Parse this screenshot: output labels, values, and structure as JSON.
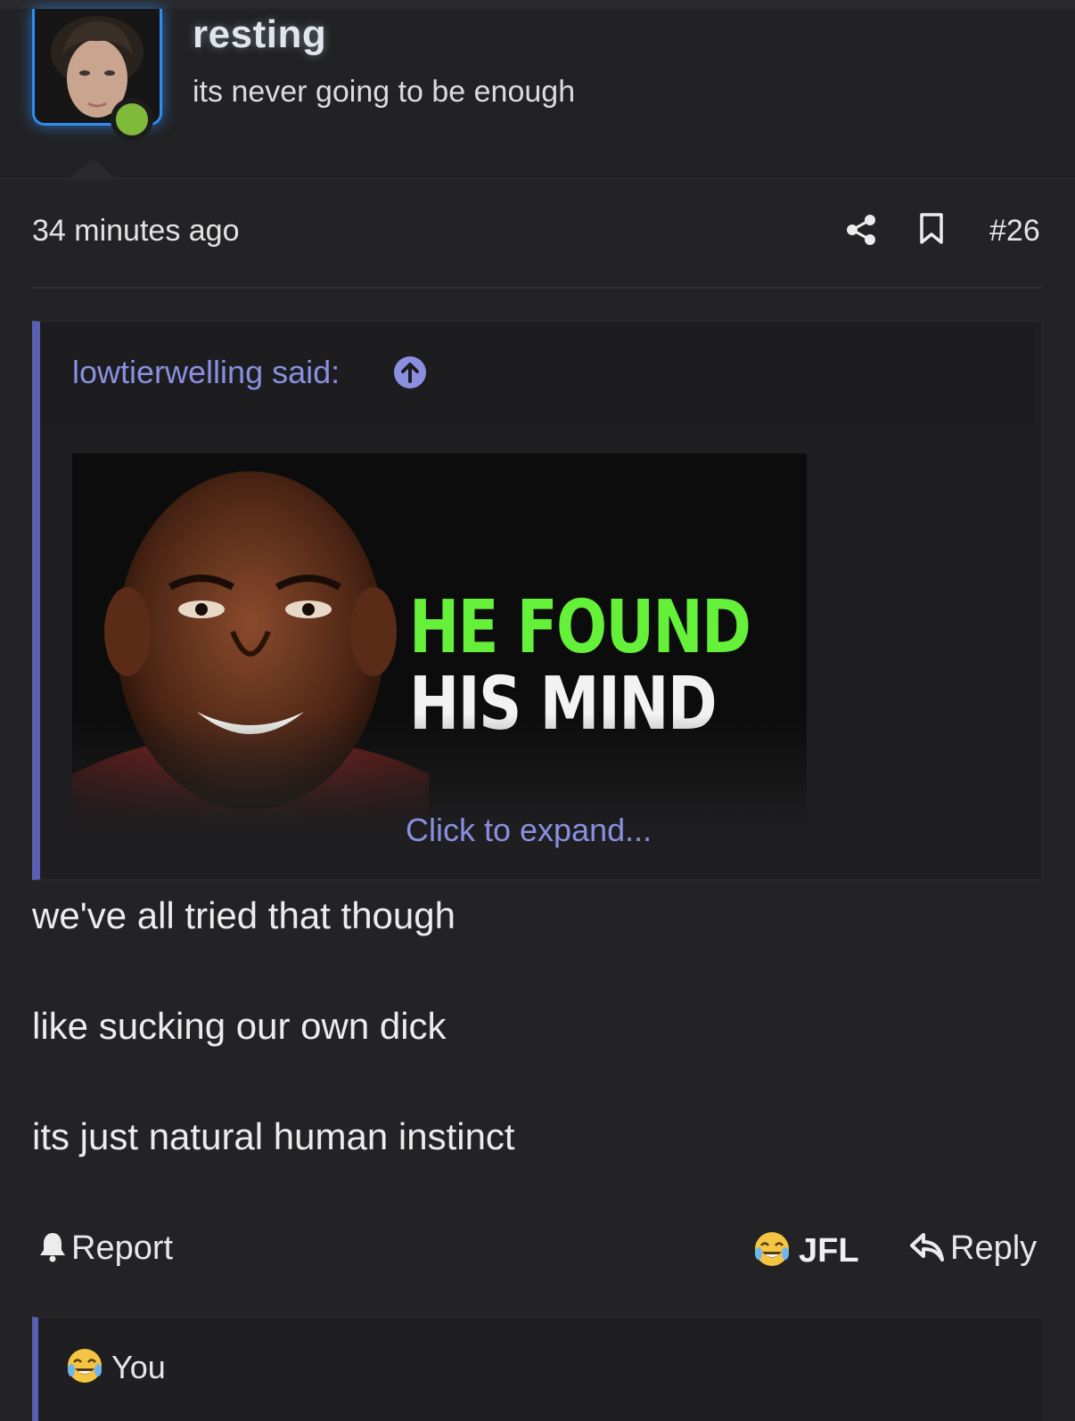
{
  "user": {
    "username": "resting",
    "title": "its never going to be enough",
    "online_color": "#7fba3a"
  },
  "post": {
    "timestamp": "34 minutes ago",
    "number": "#26",
    "icons": {
      "share": "share-icon",
      "bookmark": "bookmark-icon"
    }
  },
  "quote": {
    "author": "lowtierwelling said:",
    "author_icon": "arrow-up-circle-icon",
    "image_text": {
      "line1": "HE FOUND",
      "line2": "HIS MIND"
    },
    "expand": "Click to expand..."
  },
  "body": {
    "lines": [
      "we've all tried that though",
      "like sucking our own dick",
      "its just natural human instinct"
    ]
  },
  "actions": {
    "report": "Report",
    "reaction": "JFL",
    "reply": "Reply"
  },
  "reactions_summary": {
    "users": "You"
  },
  "colors": {
    "background": "#232325",
    "accent": "#5b5fb4",
    "link": "#8a8fe0",
    "avatar_glow": "#2f8cf0",
    "image_green": "#65f03a"
  }
}
